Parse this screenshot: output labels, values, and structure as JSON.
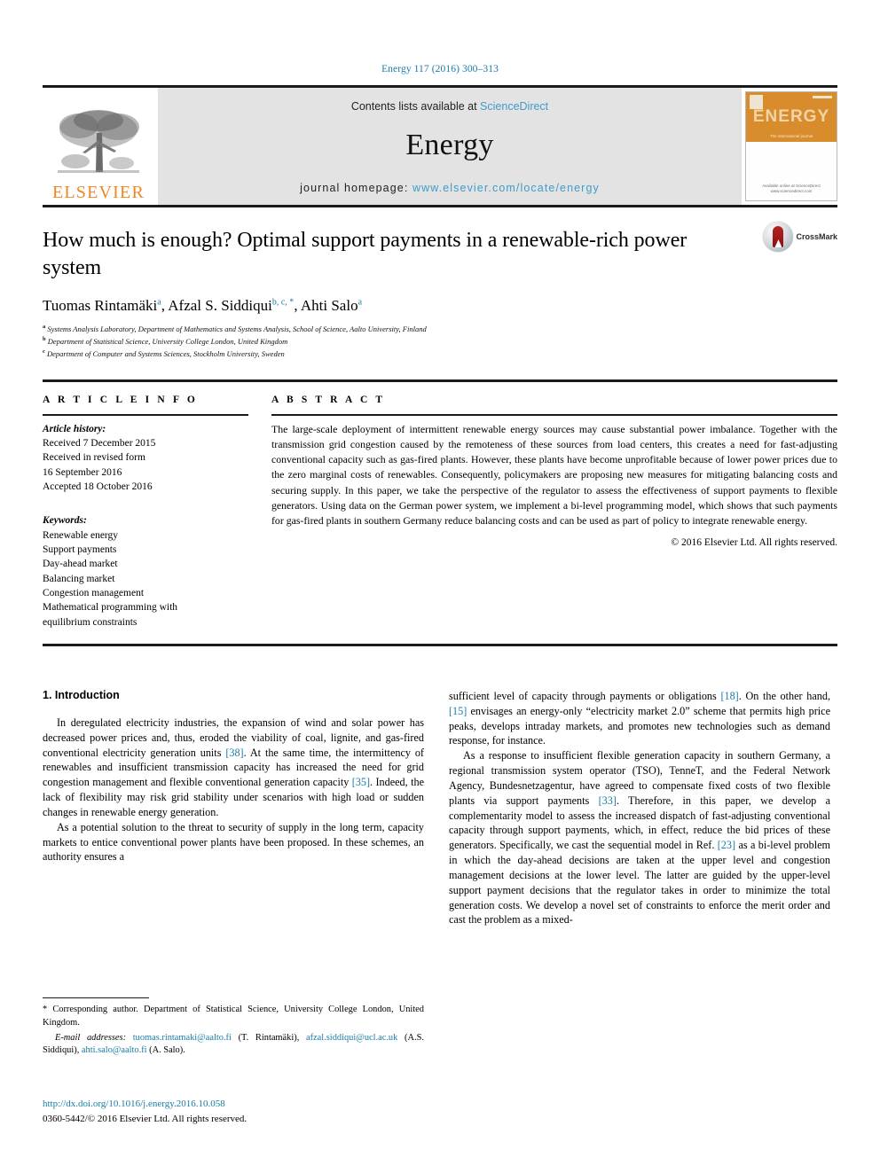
{
  "running_head": "Energy 117 (2016) 300–313",
  "masthead": {
    "publisher_name": "ELSEVIER",
    "contents_prefix": "Contents lists available at ",
    "contents_link": "ScienceDirect",
    "journal_title": "Energy",
    "homepage_prefix": "journal homepage: ",
    "homepage_url": "www.elsevier.com/locate/energy",
    "cover_title": "ENERGY",
    "cover_subtitle": "The international journal",
    "cover_footer": "Available online at\nScienceDirect\nwww.sciencedirect.com"
  },
  "article": {
    "title": "How much is enough? Optimal support payments in a renewable-rich power system",
    "crossmark_label": "CrossMark",
    "authors": [
      {
        "name": "Tuomas Rintamäki",
        "marks": "a"
      },
      {
        "name": "Afzal S. Siddiqui",
        "marks": "b, c, *"
      },
      {
        "name": "Ahti Salo",
        "marks": "a"
      }
    ],
    "affiliations": [
      {
        "mark": "a",
        "text": "Systems Analysis Laboratory, Department of Mathematics and Systems Analysis, School of Science, Aalto University, Finland"
      },
      {
        "mark": "b",
        "text": "Department of Statistical Science, University College London, United Kingdom"
      },
      {
        "mark": "c",
        "text": "Department of Computer and Systems Sciences, Stockholm University, Sweden"
      }
    ]
  },
  "article_info": {
    "heading": "A R T I C L E  I N F O",
    "history_label": "Article history:",
    "history_lines": [
      "Received 7 December 2015",
      "Received in revised form",
      "16 September 2016",
      "Accepted 18 October 2016"
    ],
    "keywords_label": "Keywords:",
    "keywords": [
      "Renewable energy",
      "Support payments",
      "Day-ahead market",
      "Balancing market",
      "Congestion management",
      "Mathematical programming with",
      "equilibrium constraints"
    ]
  },
  "abstract": {
    "heading": "A B S T R A C T",
    "text": "The large-scale deployment of intermittent renewable energy sources may cause substantial power imbalance. Together with the transmission grid congestion caused by the remoteness of these sources from load centers, this creates a need for fast-adjusting conventional capacity such as gas-fired plants. However, these plants have become unprofitable because of lower power prices due to the zero marginal costs of renewables. Consequently, policymakers are proposing new measures for mitigating balancing costs and securing supply. In this paper, we take the perspective of the regulator to assess the effectiveness of support payments to flexible generators. Using data on the German power system, we implement a bi-level programming model, which shows that such payments for gas-fired plants in southern Germany reduce balancing costs and can be used as part of policy to integrate renewable energy.",
    "copyright": "© 2016 Elsevier Ltd. All rights reserved."
  },
  "body": {
    "section_number_title": "1. Introduction",
    "left_paragraphs": [
      "In deregulated electricity industries, the expansion of wind and solar power has decreased power prices and, thus, eroded the viability of coal, lignite, and gas-fired conventional electricity generation units [38]. At the same time, the intermittency of renewables and insufficient transmission capacity has increased the need for grid congestion management and flexible conventional generation capacity [35]. Indeed, the lack of flexibility may risk grid stability under scenarios with high load or sudden changes in renewable energy generation.",
      "As a potential solution to the threat to security of supply in the long term, capacity markets to entice conventional power plants have been proposed. In these schemes, an authority ensures a"
    ],
    "right_paragraphs": [
      "sufficient level of capacity through payments or obligations [18]. On the other hand, [15] envisages an energy-only “electricity market 2.0” scheme that permits high price peaks, develops intraday markets, and promotes new technologies such as demand response, for instance.",
      "As a response to insufficient flexible generation capacity in southern Germany, a regional transmission system operator (TSO), TenneT, and the Federal Network Agency, Bundesnetzagentur, have agreed to compensate fixed costs of two flexible plants via support payments [33]. Therefore, in this paper, we develop a complementarity model to assess the increased dispatch of fast-adjusting conventional capacity through support payments, which, in effect, reduce the bid prices of these generators. Specifically, we cast the sequential model in Ref. [23] as a bi-level problem in which the day-ahead decisions are taken at the upper level and congestion management decisions at the lower level. The latter are guided by the upper-level support payment decisions that the regulator takes in order to minimize the total generation costs. We develop a novel set of constraints to enforce the merit order and cast the problem as a mixed-"
    ]
  },
  "footnote": {
    "corresponding": "* Corresponding author. Department of Statistical Science, University College London, United Kingdom.",
    "email_label": "E-mail addresses:",
    "emails": [
      {
        "address": "tuomas.rintamaki@aalto.fi",
        "owner": "(T. Rintamäki)"
      },
      {
        "address": "afzal.siddiqui@ucl.ac.uk",
        "owner": "(A.S. Siddiqui)"
      },
      {
        "address": "ahti.salo@aalto.fi",
        "owner": "(A. Salo)"
      }
    ]
  },
  "doi_block": {
    "doi_url": "http://dx.doi.org/10.1016/j.energy.2016.10.058",
    "issn_line": "0360-5442/© 2016 Elsevier Ltd. All rights reserved."
  },
  "colors": {
    "link": "#1a7ca8",
    "science_direct": "#3f9cc9",
    "elsevier_orange": "#F08522",
    "band_gray": "#e3e3e3",
    "cover_orange": "#d98c2b"
  }
}
